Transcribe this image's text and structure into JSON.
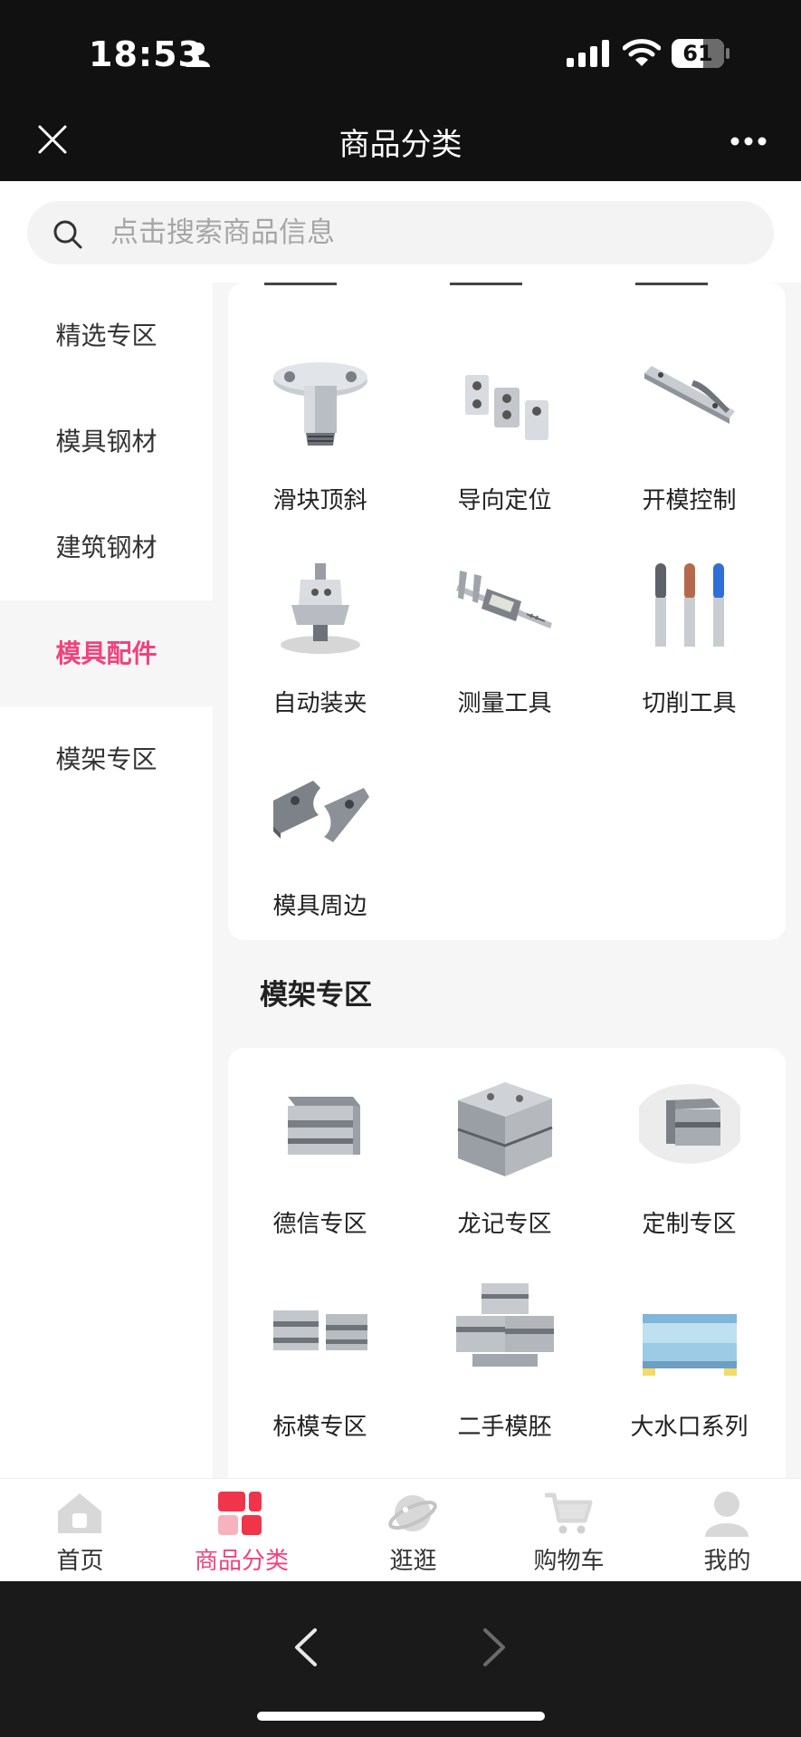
{
  "status": {
    "time": "18:53",
    "battery": "61",
    "battery_level": 0.61
  },
  "header": {
    "title": "商品分类"
  },
  "search": {
    "placeholder": "点击搜索商品信息"
  },
  "sidebar": {
    "items": [
      {
        "label": "精选专区",
        "active": false
      },
      {
        "label": "模具钢材",
        "active": false
      },
      {
        "label": "建筑钢材",
        "active": false
      },
      {
        "label": "模具配件",
        "active": true
      },
      {
        "label": "模架专区",
        "active": false
      }
    ]
  },
  "accessories": {
    "items": [
      {
        "label": "滑块顶斜",
        "icon": "slider-lifter-part-icon"
      },
      {
        "label": "导向定位",
        "icon": "guide-locator-part-icon"
      },
      {
        "label": "开模控制",
        "icon": "mold-open-control-part-icon"
      },
      {
        "label": "自动装夹",
        "icon": "auto-clamp-part-icon"
      },
      {
        "label": "测量工具",
        "icon": "caliper-icon"
      },
      {
        "label": "切削工具",
        "icon": "end-mill-icon"
      },
      {
        "label": "模具周边",
        "icon": "clamp-plate-icon"
      }
    ]
  },
  "mold_base": {
    "title": "模架专区",
    "items": [
      {
        "label": "德信专区",
        "icon": "mold-base-icon"
      },
      {
        "label": "龙记专区",
        "icon": "mold-base-icon"
      },
      {
        "label": "定制专区",
        "icon": "mold-base-icon"
      },
      {
        "label": "标模专区",
        "icon": "mold-base-icon"
      },
      {
        "label": "二手模胚",
        "icon": "mold-base-icon"
      },
      {
        "label": "大水口系列",
        "icon": "mold-base-icon"
      }
    ]
  },
  "tabbar": {
    "items": [
      {
        "label": "首页",
        "icon": "home-icon",
        "active": false
      },
      {
        "label": "商品分类",
        "icon": "category-icon",
        "active": true
      },
      {
        "label": "逛逛",
        "icon": "planet-icon",
        "active": false
      },
      {
        "label": "购物车",
        "icon": "cart-icon",
        "active": false
      },
      {
        "label": "我的",
        "icon": "profile-icon",
        "active": false
      }
    ]
  },
  "colors": {
    "accent": "#f0437d",
    "chrome": "#111111",
    "background": "#f6f6f6"
  }
}
